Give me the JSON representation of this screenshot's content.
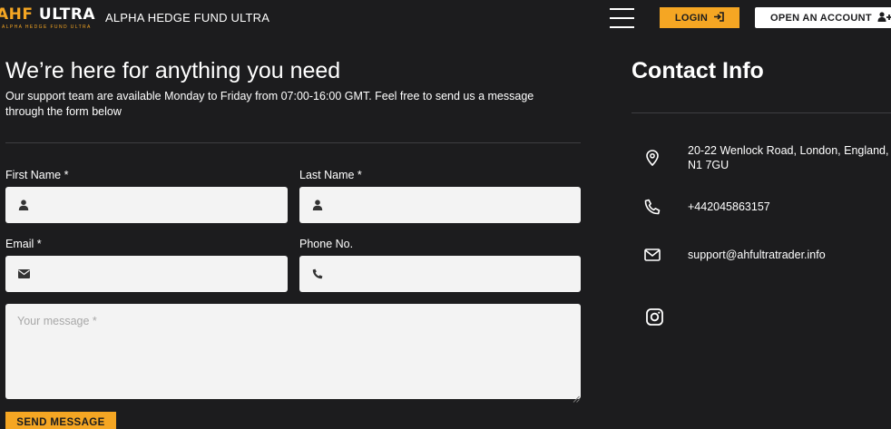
{
  "header": {
    "logo_text_primary": "AHF",
    "logo_text_secondary": "ULTRA",
    "logo_tagline": "ALPHA HEDGE FUND ULTRA",
    "brand_title": "ALPHA HEDGE FUND ULTRA",
    "login_label": "LOGIN",
    "open_account_label": "OPEN AN ACCOUNT"
  },
  "main": {
    "heading": "We’re here for anything you need",
    "subtext": "Our support team are available Monday to Friday from 07:00-16:00 GMT. Feel free to send us a message through the form below"
  },
  "form": {
    "first_name_label": "First Name *",
    "last_name_label": "Last Name *",
    "email_label": "Email *",
    "phone_label": "Phone No.",
    "first_name_value": "",
    "last_name_value": "",
    "email_value": "",
    "phone_value": "",
    "message_placeholder": "Your message *",
    "send_label": "SEND MESSAGE"
  },
  "contact": {
    "title": "Contact Info",
    "address": "20-22 Wenlock Road, London, England, N1 7GU",
    "phone": "+442045863157",
    "email": "support@ahfultratrader.info"
  },
  "colors": {
    "background": "#1c1c1e",
    "accent": "#f5a623",
    "field_bg": "#f3f3f3"
  },
  "icons": [
    "menu-icon",
    "login-icon",
    "user-plus-icon",
    "user-icon",
    "envelope-icon",
    "phone-icon",
    "map-pin-icon",
    "instagram-icon"
  ]
}
